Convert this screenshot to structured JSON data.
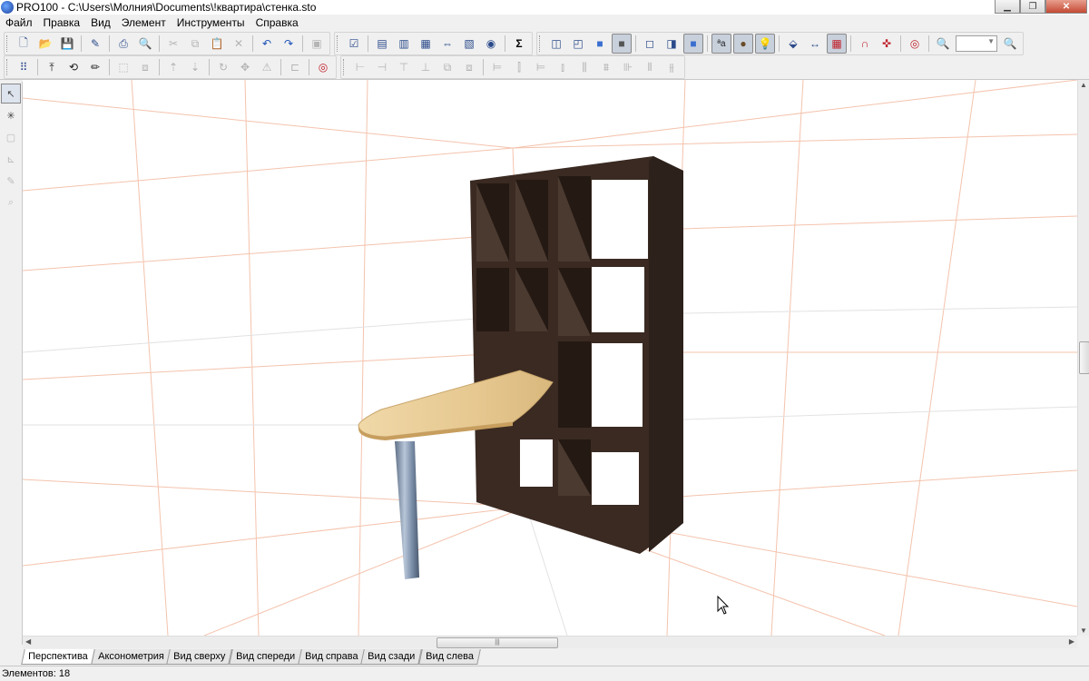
{
  "window": {
    "title": "PRO100 - C:\\Users\\Молния\\Documents\\!квартира\\стенка.sto",
    "controls": [
      "minimize",
      "maximize",
      "close"
    ]
  },
  "menu": [
    "Файл",
    "Правка",
    "Вид",
    "Элемент",
    "Инструменты",
    "Справка"
  ],
  "toolbar_top": {
    "groups": [
      [
        "new-icon",
        "open-icon",
        "save-icon",
        "properties-icon",
        "print-icon",
        "print-preview-icon",
        "cut-icon",
        "copy-icon",
        "paste-icon",
        "delete-icon",
        "undo-icon",
        "redo-icon",
        "stamp-icon"
      ],
      [
        "checklist-icon",
        "report-1-icon",
        "report-2-icon",
        "report-3-icon",
        "report-4-icon",
        "report-5-icon",
        "report-6-icon",
        "sum-icon"
      ],
      [
        "view-box-1-icon",
        "view-box-2-icon",
        "view-box-3-icon",
        "view-box-4-icon",
        "wireframe-1-icon",
        "wireframe-2-icon",
        "wireframe-3-icon",
        "texture-icon",
        "material-icon",
        "light-icon",
        "edge-icon",
        "dimension-icon",
        "grid-icon",
        "magnet-icon",
        "snap-icon",
        "target-icon",
        "zoom-out-icon",
        "zoom-in-icon"
      ]
    ],
    "zoom_value": ""
  },
  "toolbar_bottom": {
    "groups": [
      [
        "select-all-icon",
        "move-up-icon",
        "rotate-3d-icon",
        "pencil-icon",
        "frame-icon",
        "group-icon",
        "lift-icon",
        "lower-icon",
        "rotate-icon",
        "move-icon",
        "warning-icon",
        "align-icon",
        "snap-target-icon"
      ],
      [
        "align-left-icon",
        "align-hcenter-icon",
        "align-right-icon",
        "align-top-icon",
        "align-vcenter-icon",
        "align-bottom-icon",
        "distribute-1-icon",
        "distribute-2-icon",
        "distribute-3-icon",
        "distribute-4-icon",
        "distribute-5-icon",
        "distribute-6-icon",
        "distribute-7-icon",
        "distribute-8-icon",
        "distribute-9-icon",
        "distribute-10-icon"
      ]
    ]
  },
  "left_tools": [
    "pointer-icon",
    "explode-icon",
    "box-icon",
    "measure-icon",
    "edit-icon",
    "zoom-icon"
  ],
  "view_tabs": [
    "Перспектива",
    "Аксонометрия",
    "Вид сверху",
    "Вид спереди",
    "Вид справа",
    "Вид сзади",
    "Вид слева"
  ],
  "active_tab": 0,
  "status": {
    "elements_text": "Элементов: 18"
  },
  "colors": {
    "cabinet_dark": "#3a2a22",
    "cabinet_mid": "#4b3a30",
    "tabletop": "#e8cf9d",
    "leg": "#7b8ea8",
    "grid_lines": "#f4c3ad"
  }
}
